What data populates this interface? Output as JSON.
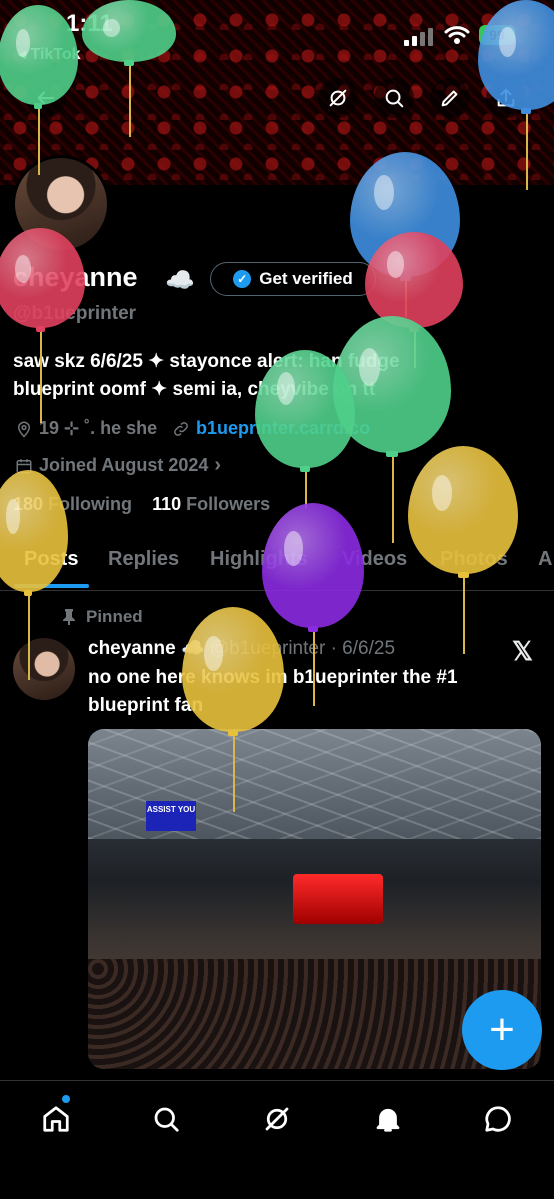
{
  "status_bar": {
    "time": "1:11",
    "back_app": "◂ TikTok",
    "battery": "99"
  },
  "profile": {
    "display_name": "cheyanne",
    "name_emoji": "☁️",
    "handle": "@b1ueprinter",
    "get_verified_label": "Get verified",
    "bio_line1": "saw skz 6/6/25 ✦ stayonce alert: han fudge",
    "bio_line2": "blueprint oomf ✦ semi ia, cheyvibe on tt",
    "location": "19 ⊹ ˚. he she",
    "link": "b1ueprinter.carrd.co",
    "joined": "Joined August 2024",
    "following_count": "180",
    "following_label": "Following",
    "followers_count": "110",
    "followers_label": "Followers"
  },
  "tabs": [
    "Posts",
    "Replies",
    "Highlights",
    "Videos",
    "Photos",
    "A"
  ],
  "post": {
    "pinned_label": "Pinned",
    "author": "cheyanne",
    "author_emoji": "☁️",
    "handle_date": "@b1ueprinter · 6/6/25",
    "text": "no one here knows im b1ueprinter the #1 blueprint fan",
    "image_sign": "ASSIST YOU"
  },
  "fab_label": "+",
  "colors": {
    "accent": "#1d9bf0",
    "muted": "#71767b",
    "balloon_green": "#4fd08a",
    "balloon_blue": "#3f8fe0",
    "balloon_red": "#e0415e",
    "balloon_yellow": "#e8c13c",
    "balloon_purple": "#8a2be2"
  },
  "icons": {
    "header": [
      "back-arrow-icon",
      "grok-icon",
      "search-icon",
      "edit-icon",
      "share-icon"
    ],
    "bottom_nav": [
      "home-icon",
      "search-icon",
      "grok-icon",
      "notifications-icon",
      "messages-icon"
    ]
  }
}
